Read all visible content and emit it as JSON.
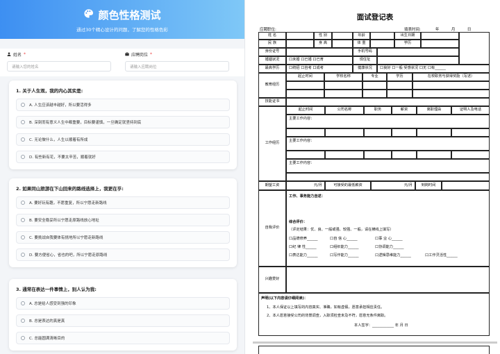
{
  "quiz": {
    "title": "颜色性格测试",
    "subtitle": "通过30个精心设计的问题，了解您的性格色彩",
    "name_label": "姓名",
    "name_placeholder": "请输入您的姓名",
    "position_label": "应聘岗位",
    "position_placeholder": "请输入应聘岗位",
    "required_mark": "*",
    "questions": [
      {
        "title": "1. 关于人生观，我的内心其实是:",
        "options": [
          "A. 人生应该越丰越好，所以要活得多",
          "B. 深刻而有意义人生中都重要，目标要谨慎，一旦确定就坚持到底",
          "C. 无论做什么，人生以顺着有所成",
          "D. 有些新有花，不要太辛苦，顺着就好"
        ]
      },
      {
        "title": "2. 如果同山旅游在下山回来的路线选择上，我更在乎:",
        "options": [
          "A. 要好玩有趣，不愿重复，所以宁愿走新路线",
          "B. 要安全稳妥所以宁愿走原路线放心地址",
          "C. 要挑战自我要体有挑地所以宁愿走新路线",
          "D. 要方便省心，省也的吧，所以宁愿走原路线"
        ]
      },
      {
        "title": "3. 通常在表达一件事情上，别人认为我:",
        "options": [
          "A. 总是给人感受到强的印象",
          "B. 总是表达的真是真",
          "C. 总能圆满清晰目的"
        ]
      }
    ]
  },
  "form": {
    "title": "面试登记表",
    "position_label": "应聘职位:",
    "date_label": "填表时间:",
    "year": "年",
    "month": "月",
    "day": "日",
    "row1": [
      "姓  名",
      "性  别",
      "年龄",
      "出生日期"
    ],
    "row2": [
      "民  族",
      "身  高",
      "体  重",
      "学历"
    ],
    "id_label": "身份证号",
    "phone_label": "手机号码",
    "marital_label": "婚姻状况",
    "marital_opts": "口未婚  口已婚  口已育",
    "address_label": "现住址",
    "edu_label": "最高学历",
    "edu_opts": "口统招  口自考  口成考",
    "health_label": "健康状况",
    "health_opts": "口良好  口一般   受感状况  口无  口有______",
    "edu_exp_label": "教育经历",
    "edu_cols": [
      "起止时间",
      "学校名称",
      "专业",
      "学历",
      "在校职务与获得奖励（写述）"
    ],
    "cert_label": "技能证书",
    "work_label": "工作经历",
    "work_cols": [
      "起止时间",
      "公司名称",
      "职务",
      "薪资",
      "离职理由",
      "证明人及电话"
    ],
    "work_content": "主要工作内容：",
    "salary_label": "期望工资",
    "salary_unit": "元/月",
    "salary_min_label": "可接受的最低薪资",
    "salary_min_unit": "元/月",
    "start_label": "到岗时间",
    "self_label": "自我评价",
    "self_work": "工作、事务能力自述：",
    "self_comment": "综合评价：",
    "self_hint": "（评定结果：优、良、一般或强、较强、一般，请在横线上填写）",
    "traits": [
      [
        "口品德修养______",
        "口自  信  心______",
        "口事  业  心______"
      ],
      [
        "口纪  律  性______",
        "口组织能力______",
        "口协调能力______"
      ],
      [
        "口表达能力______",
        "口写作能力______",
        "口逻辑思维能力______",
        "口工作灵活性______"
      ]
    ],
    "hobby_label": "兴趣爱好",
    "declare_title": "声明(以下内容请仔细阅读)：",
    "declare_1": "1、本人保证以上填写的内容真实、准确，如有虚假，愿意承担相应责任。",
    "declare_2": "2、本人愿意接受公司的背景调查，入职须检查未及不符，愿意无条件离职。",
    "signature_label": "本人签字",
    "sig_year": "年",
    "sig_month": "月",
    "sig_day": "日"
  }
}
